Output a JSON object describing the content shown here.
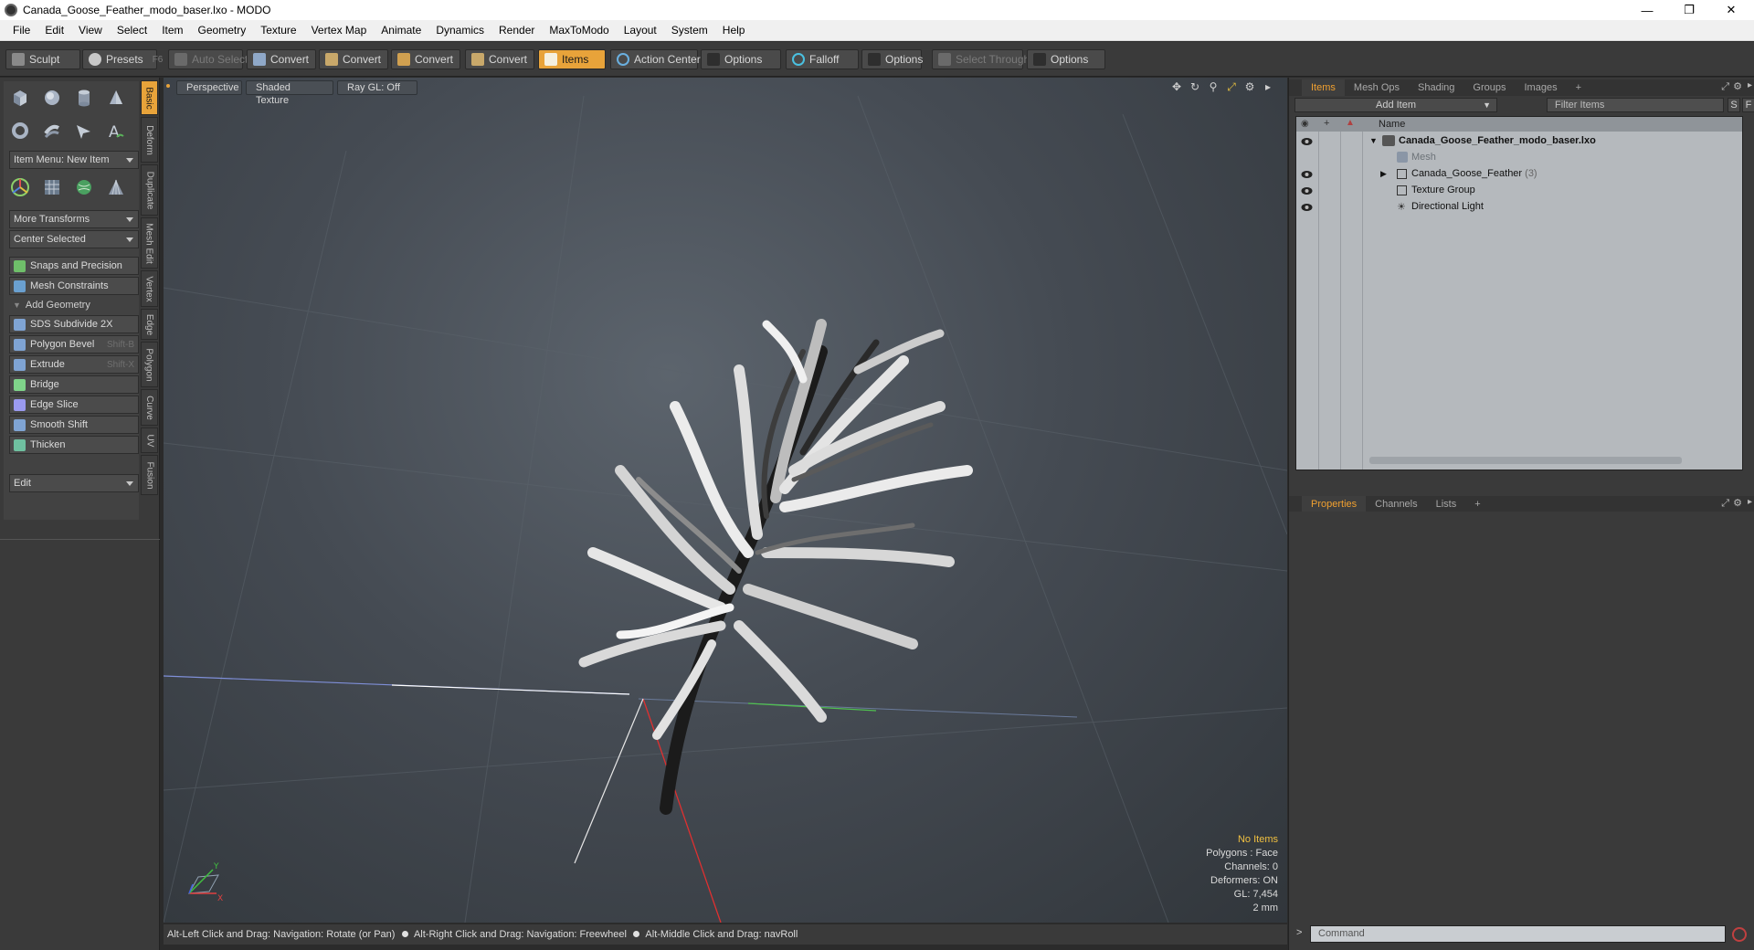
{
  "window": {
    "title": "Canada_Goose_Feather_modo_baser.lxo - MODO",
    "controls": [
      "minimize",
      "restore",
      "close"
    ]
  },
  "menu": [
    "File",
    "Edit",
    "View",
    "Select",
    "Item",
    "Geometry",
    "Texture",
    "Vertex Map",
    "Animate",
    "Dynamics",
    "Render",
    "MaxToModo",
    "Layout",
    "System",
    "Help"
  ],
  "toolbar": {
    "sculpt": "Sculpt",
    "presets": "Presets",
    "presets_shortcut": "F6",
    "auto_select": "Auto Select",
    "convert1": "Convert",
    "convert2": "Convert",
    "convert3": "Convert",
    "convert4": "Convert",
    "items": "Items",
    "action_center": "Action Center",
    "options1": "Options",
    "falloff": "Falloff",
    "options2": "Options",
    "select_through": "Select Through",
    "options3": "Options"
  },
  "left": {
    "item_menu": "Item Menu: New Item",
    "more_transforms": "More Transforms",
    "center_selected": "Center Selected",
    "snaps": "Snaps and Precision",
    "mesh_constraints": "Mesh Constraints",
    "add_geometry": "Add Geometry",
    "tools": [
      {
        "label": "SDS Subdivide 2X",
        "shortcut": ""
      },
      {
        "label": "Polygon Bevel",
        "shortcut": "Shift-B"
      },
      {
        "label": "Extrude",
        "shortcut": "Shift-X"
      },
      {
        "label": "Bridge",
        "shortcut": ""
      },
      {
        "label": "Edge Slice",
        "shortcut": ""
      },
      {
        "label": "Smooth Shift",
        "shortcut": ""
      },
      {
        "label": "Thicken",
        "shortcut": ""
      }
    ],
    "edit": "Edit",
    "vtabs": [
      "Basic",
      "Deform",
      "Duplicate",
      "Mesh Edit",
      "Vertex",
      "Edge",
      "Polygon",
      "Curve",
      "UV",
      "Fusion"
    ]
  },
  "viewport": {
    "perspective": "Perspective",
    "shading": "Shaded Texture",
    "raygl": "Ray GL: Off",
    "info": {
      "no_items": "No Items",
      "polygons": "Polygons : Face",
      "channels": "Channels: 0",
      "deformers": "Deformers: ON",
      "gl": "GL: 7,454",
      "scale": "2 mm"
    },
    "axis_x": "X",
    "axis_y": "Y"
  },
  "status": {
    "hint1": "Alt-Left Click and Drag: Navigation: Rotate (or Pan)",
    "hint2": "Alt-Right Click and Drag: Navigation: Freewheel",
    "hint3": "Alt-Middle Click and Drag: navRoll"
  },
  "items_panel": {
    "tabs": [
      "Items",
      "Mesh Ops",
      "Shading",
      "Groups",
      "Images",
      "+"
    ],
    "add_item": "Add Item",
    "filter_placeholder": "Filter Items",
    "filter_s": "S",
    "filter_f": "F",
    "column_name": "Name",
    "tree": [
      {
        "label": "Canada_Goose_Feather_modo_baser.lxo",
        "suffix": ""
      },
      {
        "label": "Mesh",
        "suffix": ""
      },
      {
        "label": "Canada_Goose_Feather",
        "suffix": "(3)"
      },
      {
        "label": "Texture Group",
        "suffix": ""
      },
      {
        "label": "Directional Light",
        "suffix": ""
      }
    ]
  },
  "props_panel": {
    "tabs": [
      "Properties",
      "Channels",
      "Lists",
      "+"
    ]
  },
  "command": {
    "placeholder": "Command"
  },
  "colors": {
    "accent": "#e8a33a",
    "viewport_bg": "#454b53"
  }
}
